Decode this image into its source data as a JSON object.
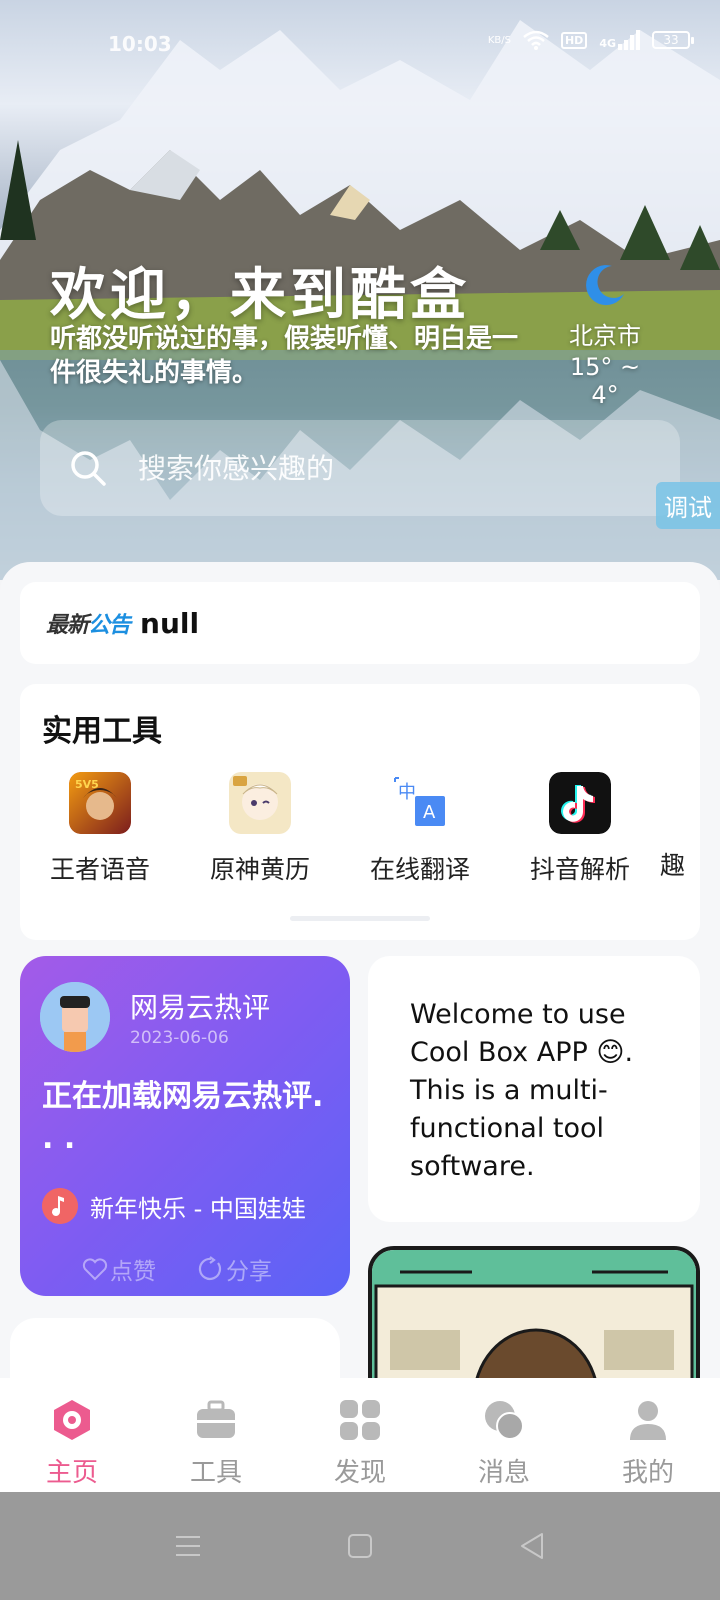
{
  "status_bar": {
    "time": "10:03",
    "net_speed": "KB/S",
    "hd": "HD",
    "network": "4G",
    "battery": "33"
  },
  "hero": {
    "title": "欢迎，来到酷盒",
    "subtitle": "听都没听说过的事，假装听懂、明白是一件很失礼的事情。",
    "weather": {
      "icon": "crescent-moon-icon",
      "city": "北京市",
      "temp": "15° ~ 4°"
    },
    "search": {
      "placeholder": "搜索你感兴趣的"
    },
    "debug_label": "调试"
  },
  "notice": {
    "logo_part1": "最新",
    "logo_part2": "公告",
    "text": "null"
  },
  "tools": {
    "title": "实用工具",
    "items": [
      {
        "label": "王者语音",
        "icon": "honor-of-kings-icon"
      },
      {
        "label": "原神黄历",
        "icon": "genshin-icon"
      },
      {
        "label": "在线翻译",
        "icon": "translate-icon"
      },
      {
        "label": "抖音解析",
        "icon": "tiktok-icon"
      },
      {
        "label": "趣",
        "icon": "partial-tool-icon"
      }
    ]
  },
  "music_card": {
    "title": "网易云热评",
    "date": "2023-06-06",
    "comment": "正在加载网易云热评. . .",
    "song": "新年快乐 - 中国娃娃",
    "like": "点赞",
    "share": "分享"
  },
  "welcome_card": {
    "text": "Welcome to use Cool Box APP 😊. This is a multi-functional tool software."
  },
  "tabbar": {
    "tabs": [
      {
        "label": "主页",
        "icon": "home-icon",
        "active": true
      },
      {
        "label": "工具",
        "icon": "briefcase-icon",
        "active": false
      },
      {
        "label": "发现",
        "icon": "grid-icon",
        "active": false
      },
      {
        "label": "消息",
        "icon": "chat-icon",
        "active": false
      },
      {
        "label": "我的",
        "icon": "profile-icon",
        "active": false
      }
    ]
  },
  "colors": {
    "accent": "#ec5b8f",
    "music_card_start": "#a35be8",
    "music_card_end": "#5a63f6",
    "notice_accent": "#1c8fe0"
  }
}
